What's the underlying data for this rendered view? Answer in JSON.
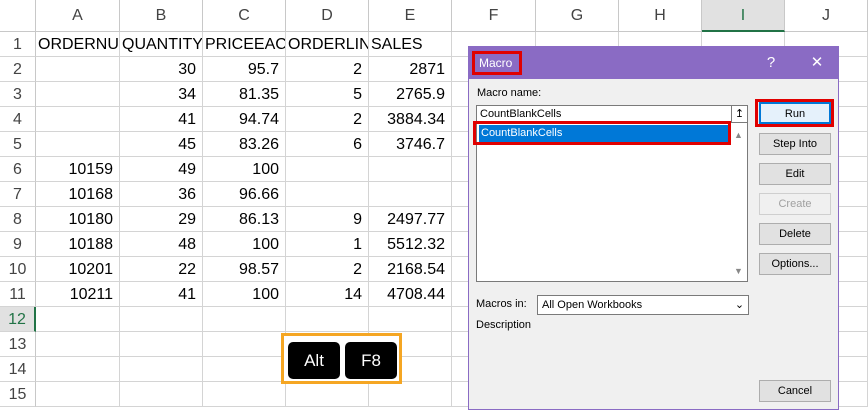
{
  "spreadsheet": {
    "columns": [
      "A",
      "B",
      "C",
      "D",
      "E",
      "F",
      "G",
      "H",
      "I",
      "J"
    ],
    "rows": [
      "1",
      "2",
      "3",
      "4",
      "5",
      "6",
      "7",
      "8",
      "9",
      "10",
      "11",
      "12",
      "13",
      "14",
      "15"
    ],
    "headers": [
      "ORDERNU",
      "QUANTITY",
      "PRICEEACH",
      "ORDERLIN",
      "SALES"
    ],
    "data": [
      [
        "",
        "30",
        "95.7",
        "2",
        "2871"
      ],
      [
        "",
        "34",
        "81.35",
        "5",
        "2765.9"
      ],
      [
        "",
        "41",
        "94.74",
        "2",
        "3884.34"
      ],
      [
        "",
        "45",
        "83.26",
        "6",
        "3746.7"
      ],
      [
        "10159",
        "49",
        "100",
        "",
        ""
      ],
      [
        "10168",
        "36",
        "96.66",
        "",
        ""
      ],
      [
        "10180",
        "29",
        "86.13",
        "9",
        "2497.77"
      ],
      [
        "10188",
        "48",
        "100",
        "1",
        "5512.32"
      ],
      [
        "10201",
        "22",
        "98.57",
        "2",
        "2168.54"
      ],
      [
        "10211",
        "41",
        "100",
        "14",
        "4708.44"
      ]
    ]
  },
  "shortcut": {
    "key1": "Alt",
    "key2": "F8"
  },
  "dialog": {
    "title": "Macro",
    "help": "?",
    "close": "✕",
    "macro_name_label": "Macro name:",
    "macro_name_value": "CountBlankCells",
    "macros": [
      "CountBlankCells"
    ],
    "up_icon": "↥",
    "buttons": {
      "run": "Run",
      "step_into": "Step Into",
      "edit": "Edit",
      "create": "Create",
      "delete": "Delete",
      "options": "Options..."
    },
    "macros_in_label": "Macros in:",
    "macros_in_value": "All Open Workbooks",
    "description_label": "Description",
    "cancel": "Cancel"
  },
  "colors": {
    "title_bar": "#8a6bc4",
    "highlight": "#e00000",
    "key_frame": "#f5a623",
    "selection": "#0078d7"
  }
}
